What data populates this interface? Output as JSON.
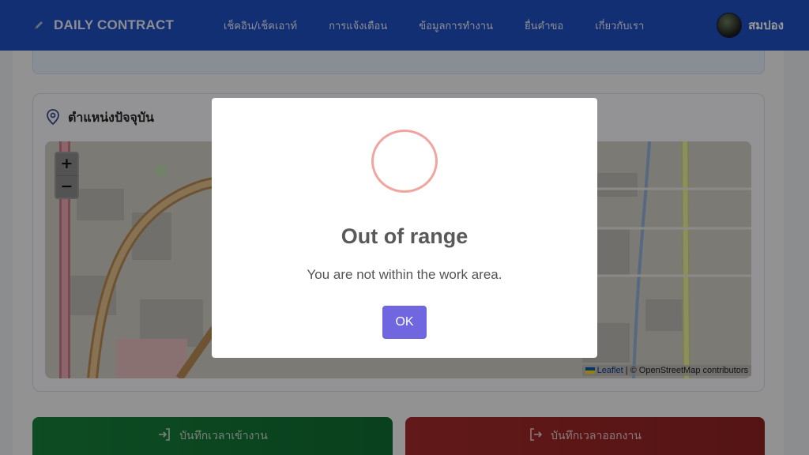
{
  "brand": {
    "name": "DAILY CONTRACT"
  },
  "nav": {
    "items": [
      {
        "label": "เช็คอิน/เช็คเอาท์"
      },
      {
        "label": "การแจ้งเตือน"
      },
      {
        "label": "ข้อมูลการทำงาน"
      },
      {
        "label": "ยื่นคำขอ"
      },
      {
        "label": "เกี่ยวกับเรา"
      }
    ]
  },
  "user": {
    "name": "สมปอง"
  },
  "location_card": {
    "title": "ตำแหน่งปัจจุบัน"
  },
  "map": {
    "zoom_in": "+",
    "zoom_out": "−",
    "attribution_leaflet": "Leaflet",
    "attribution_rest": " | © OpenStreetMap contributors"
  },
  "actions": {
    "checkin_label": "บันทึกเวลาเข้างาน",
    "checkout_label": "บันทึกเวลาออกงาน"
  },
  "dialog": {
    "title": "Out of range",
    "message": "You are not within the work area.",
    "confirm_label": "OK"
  },
  "colors": {
    "navbar": "#1e4fc0",
    "checkin": "#17803b",
    "checkout": "#a32a2a",
    "dialog_button": "#7066e0",
    "dialog_ring": "#f2a49f"
  },
  "icons": {
    "brand": "pencil-icon",
    "location": "map-pin-icon",
    "checkin": "sign-in-icon",
    "checkout": "sign-out-icon"
  }
}
